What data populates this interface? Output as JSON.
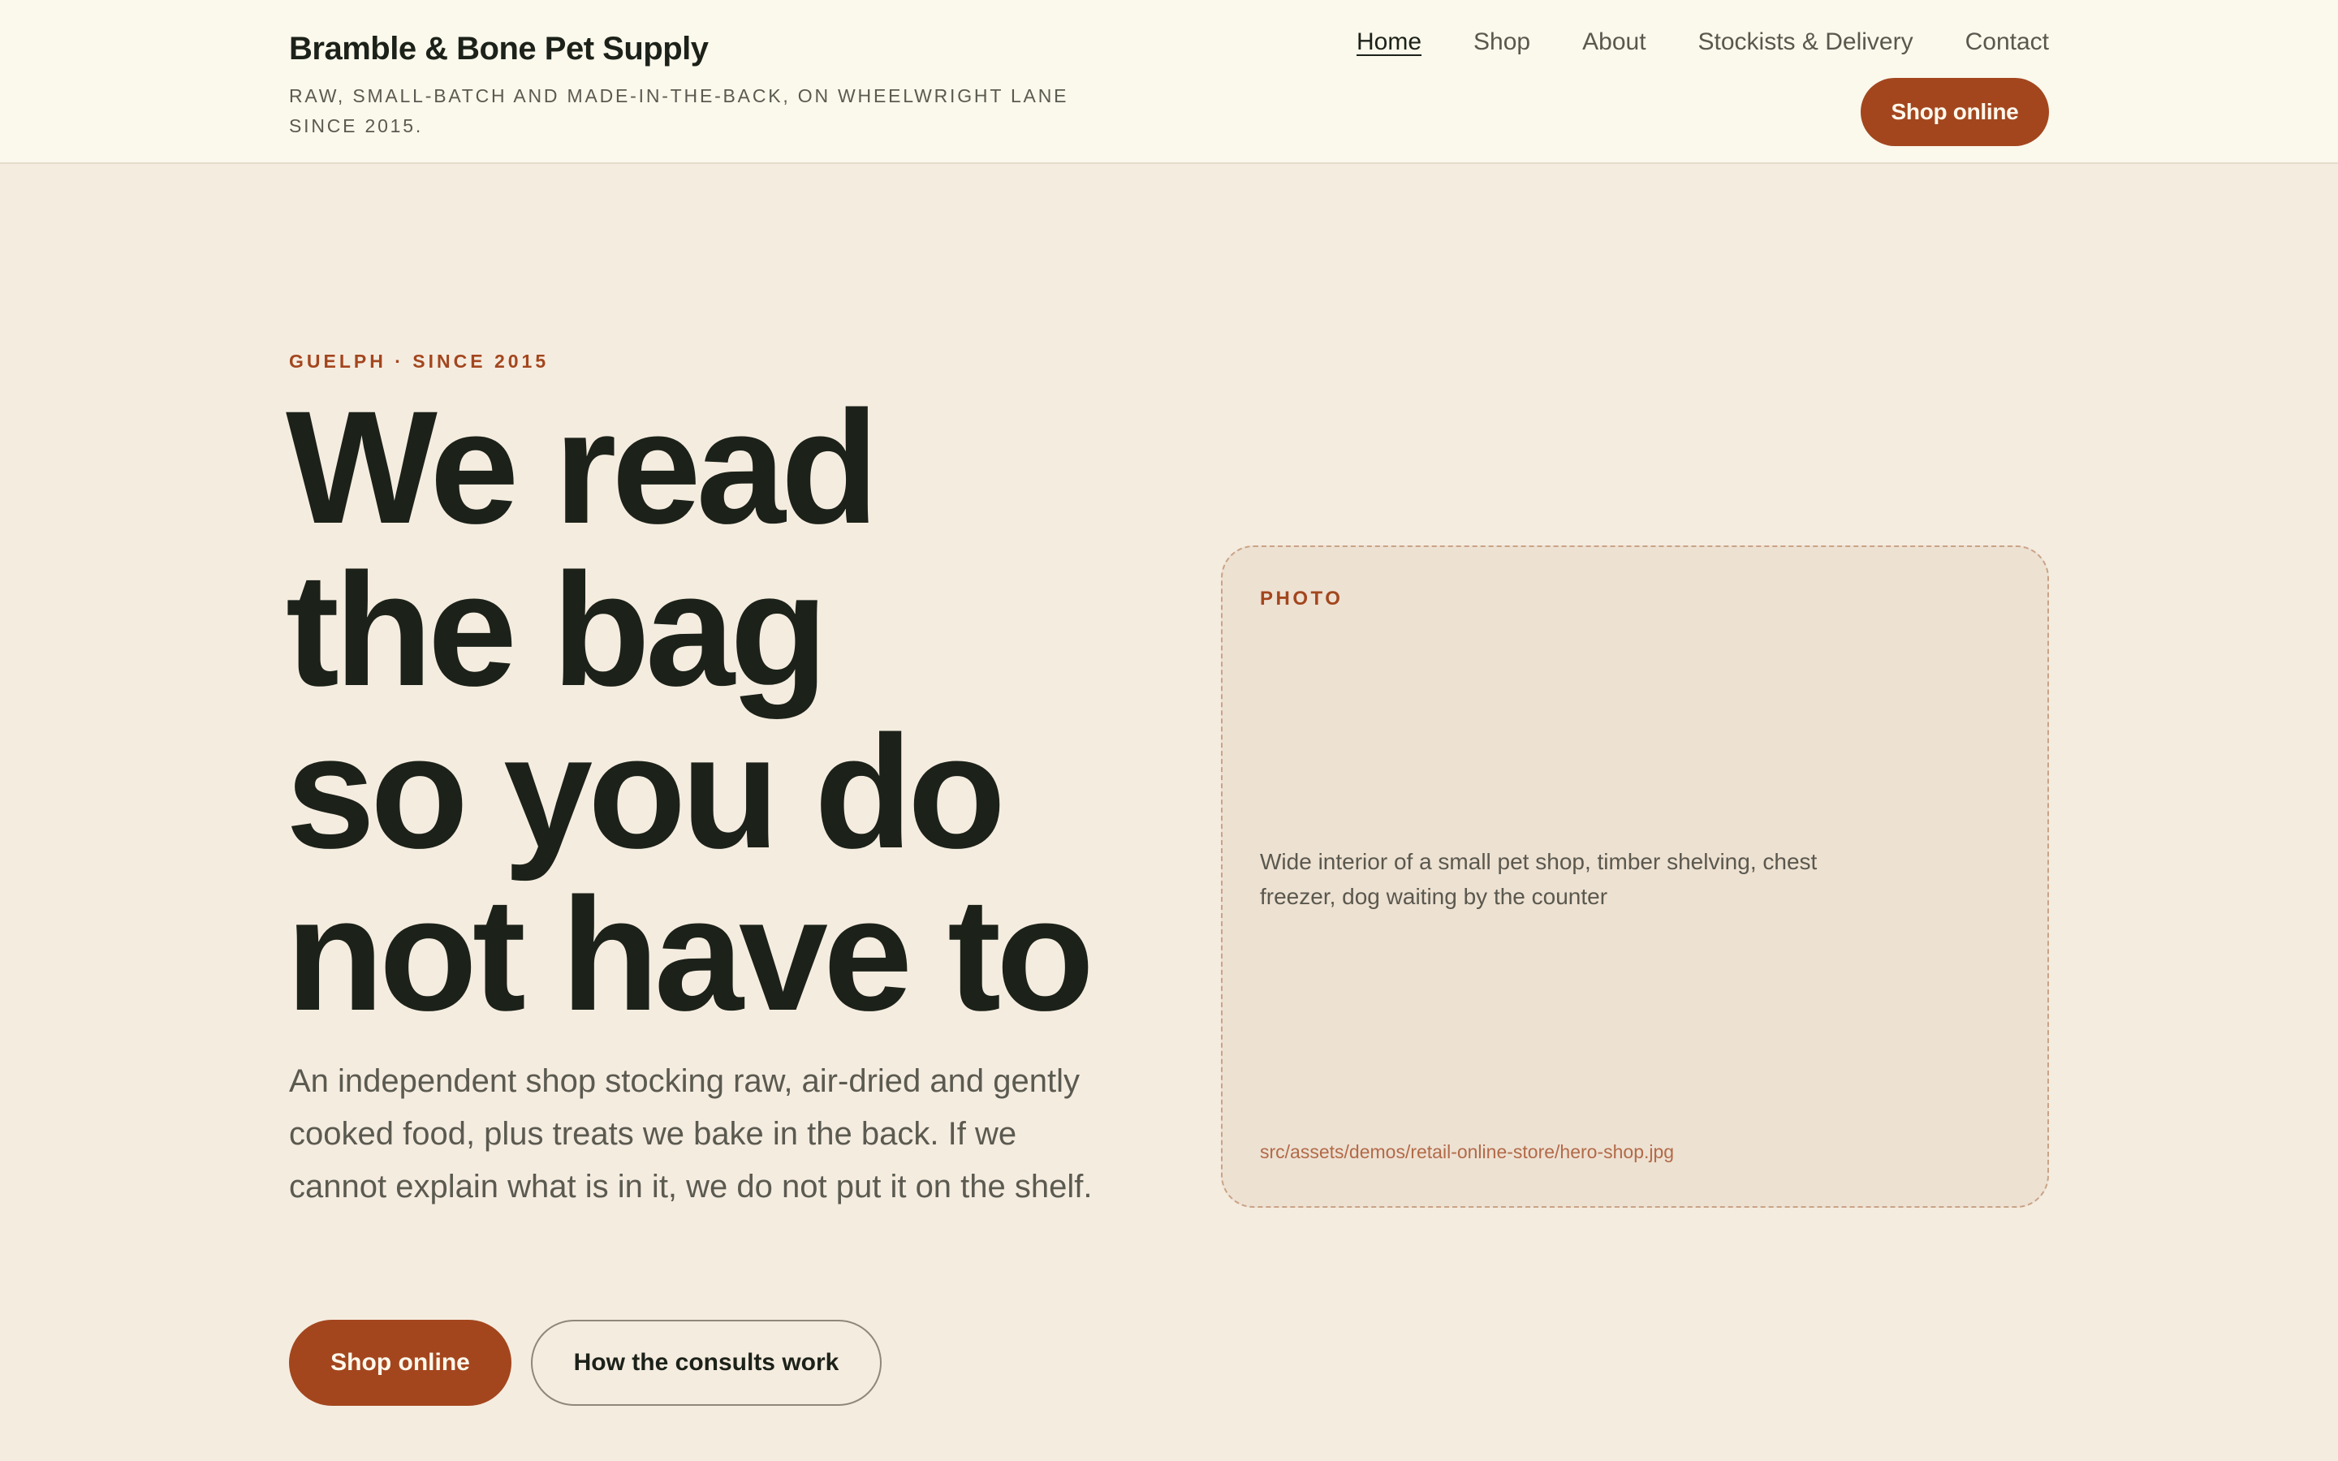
{
  "brand": {
    "name": "Bramble & Bone Pet Supply",
    "tagline": "RAW, SMALL-BATCH AND MADE-IN-THE-BACK, ON WHEELWRIGHT LANE SINCE 2015."
  },
  "nav": {
    "items": [
      "Home",
      "Shop",
      "About",
      "Stockists & Delivery",
      "Contact"
    ],
    "active": "Home",
    "cta_label": "Shop online"
  },
  "hero": {
    "eyebrow": "GUELPH · SINCE 2015",
    "title_lines": [
      "We read",
      "the bag",
      "so you do",
      "not have to"
    ],
    "body": "An independent shop stocking raw, air-dried and gently cooked food, plus treats we bake in the back. If we cannot explain what is in it, we do not put it on the shelf.",
    "primary_button": "Shop online",
    "secondary_button": "How the consults work"
  },
  "photo": {
    "label": "PHOTO",
    "description": "Wide interior of a small pet shop, timber shelving, chest freezer, dog waiting by the counter",
    "path": "src/assets/demos/retail-online-store/hero-shop.jpg"
  },
  "colors": {
    "accent": "#a3461e",
    "header_bg": "#fbf8ec",
    "page_bg": "#f5ece0",
    "card_bg": "#ede1d2",
    "ink": "#1c2219"
  }
}
